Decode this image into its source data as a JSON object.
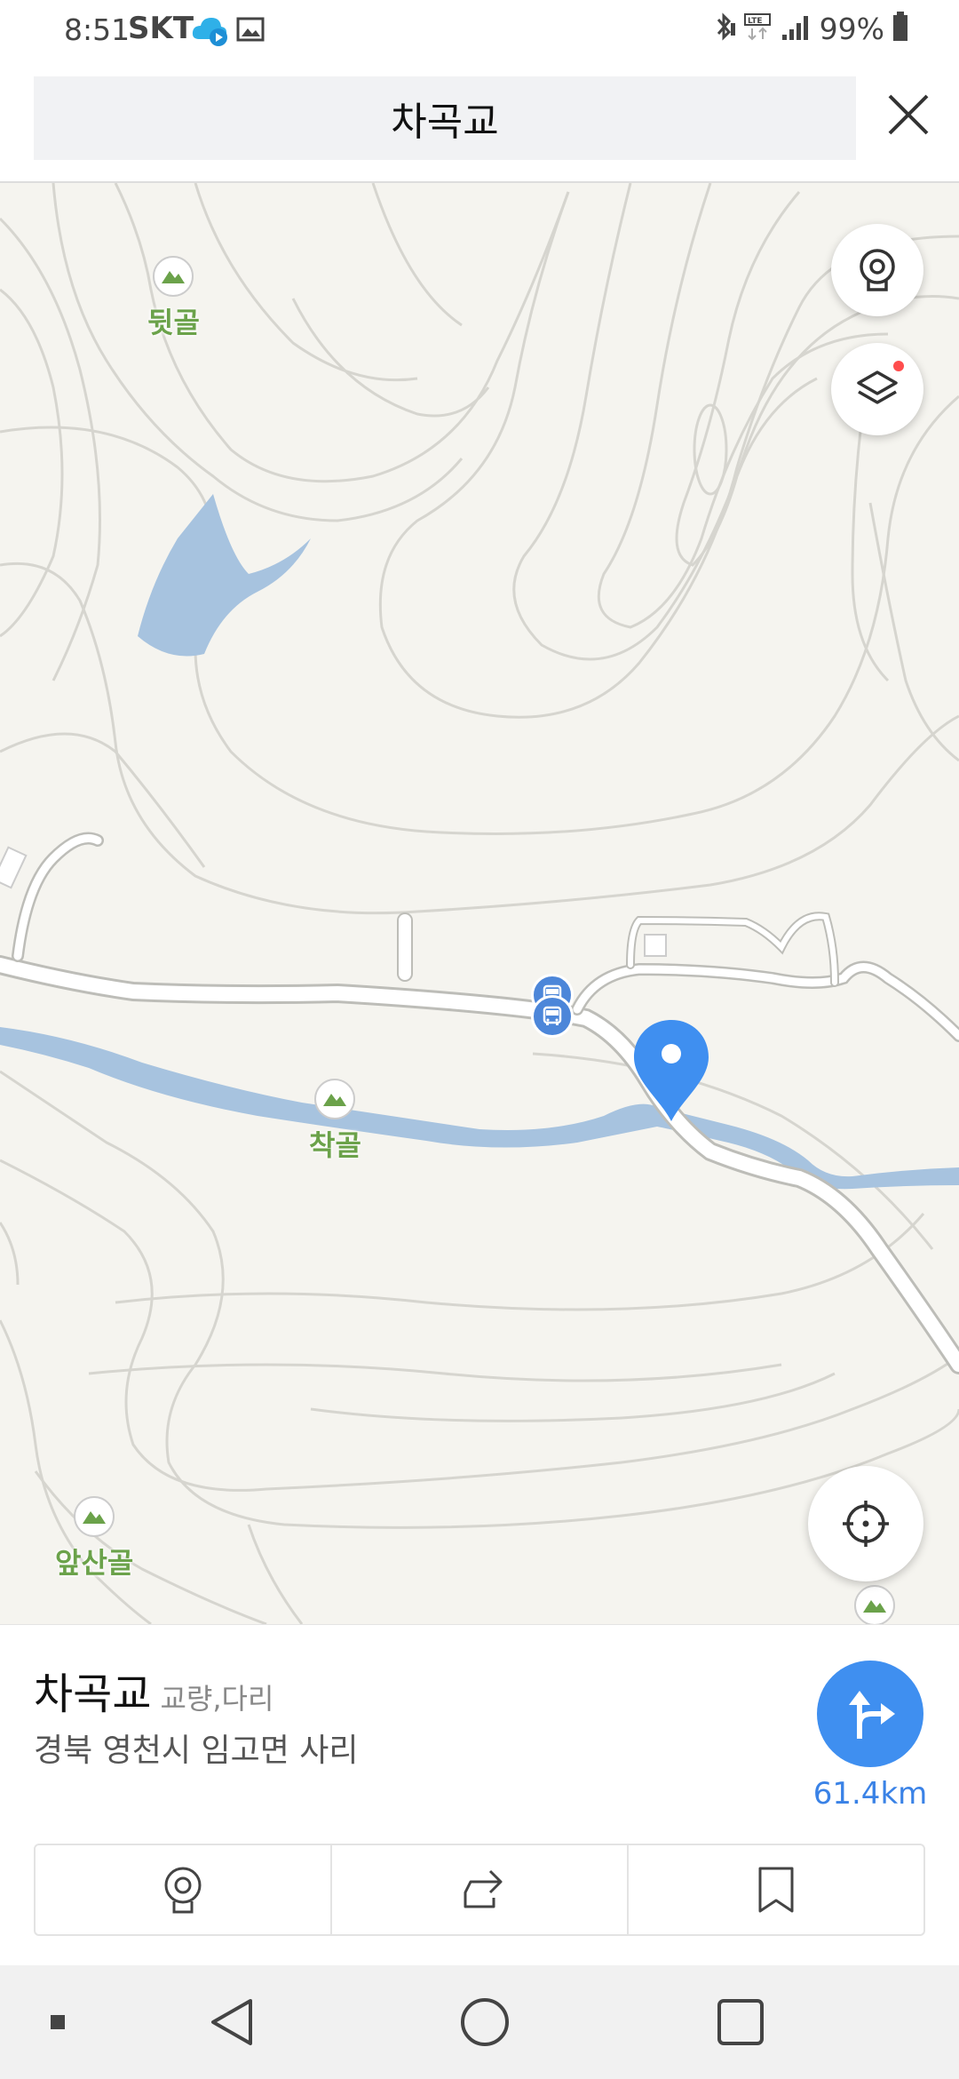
{
  "status_bar": {
    "time": "8:51",
    "carrier": "SKT",
    "battery": "99%",
    "icons": [
      "cloud-icon",
      "gallery-icon",
      "bluetooth-icon",
      "lte-icon",
      "signal-icon",
      "battery-icon"
    ]
  },
  "header": {
    "search_title": "차곡교",
    "close_icon": "close-icon"
  },
  "map": {
    "pois": [
      {
        "label": "뒷골",
        "icon": "mountain-icon"
      },
      {
        "label": "착골",
        "icon": "mountain-icon"
      },
      {
        "label": "앞산골",
        "icon": "mountain-icon"
      },
      {
        "label": "",
        "icon": "mountain-icon"
      }
    ],
    "buttons": {
      "cctv": "cctv-icon",
      "layers": "layers-icon",
      "current_location": "crosshair-icon"
    },
    "colors": {
      "land": "#f5f4ef",
      "water": "#a7c3df",
      "contour": "#d6d5cf",
      "pin": "#3f8ff0",
      "poi_label": "#6ba24a"
    }
  },
  "place": {
    "name": "차곡교",
    "category": "교량,다리",
    "address": "경북 영천시 임고면 사리",
    "distance": "61.4km",
    "route_icon": "route-icon",
    "actions": [
      {
        "icon": "cctv-icon"
      },
      {
        "icon": "share-icon"
      },
      {
        "icon": "bookmark-icon"
      }
    ]
  },
  "nav_bar": {
    "items": [
      "recent-dot-icon",
      "back-icon",
      "home-icon",
      "overview-icon"
    ]
  }
}
